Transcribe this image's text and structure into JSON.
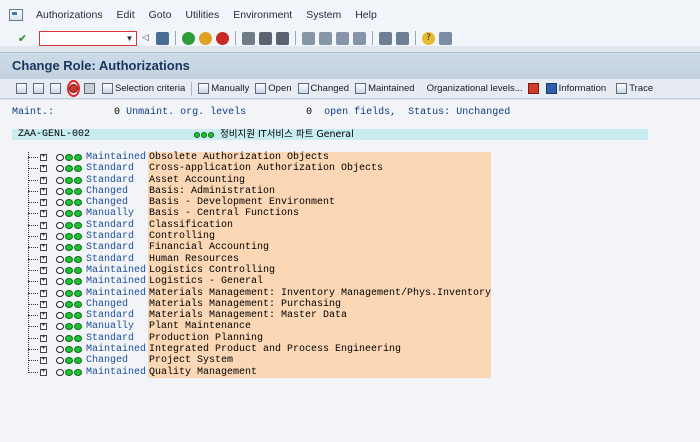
{
  "menu": {
    "items": [
      "Authorizations",
      "Edit",
      "Goto",
      "Utilities",
      "Environment",
      "System",
      "Help"
    ]
  },
  "command_field": {
    "value": "",
    "placeholder": ""
  },
  "title": "Change Role: Authorizations",
  "app_toolbar": {
    "selection_criteria": "Selection criteria",
    "manually": "Manually",
    "open": "Open",
    "changed": "Changed",
    "maintained": "Maintained",
    "org_levels": "Organizational levels...",
    "information": "Information",
    "trace": "Trace"
  },
  "status_line": {
    "maint_label": "Maint.:",
    "unmaint_count": "0",
    "unmaint_label": "Unmaint. org. levels",
    "open_count": "0",
    "open_label": "open fields,",
    "status_label": "Status:",
    "status_value": "Unchanged"
  },
  "role": {
    "id": "ZAA-GENL-002",
    "description": "정비지원 IT서비스 파트 General"
  },
  "tree": [
    {
      "status": "Maintained",
      "text": "Obsolete Authorization Objects"
    },
    {
      "status": "Standard",
      "text": "Cross-application Authorization Objects"
    },
    {
      "status": "Standard",
      "text": "Asset Accounting"
    },
    {
      "status": "Changed",
      "text": "Basis: Administration"
    },
    {
      "status": "Changed",
      "text": "Basis - Development Environment"
    },
    {
      "status": "Manually",
      "text": "Basis - Central Functions"
    },
    {
      "status": "Standard",
      "text": "Classification"
    },
    {
      "status": "Standard",
      "text": "Controlling"
    },
    {
      "status": "Standard",
      "text": "Financial Accounting"
    },
    {
      "status": "Standard",
      "text": "Human Resources"
    },
    {
      "status": "Maintained",
      "text": "Logistics Controlling"
    },
    {
      "status": "Maintained",
      "text": "Logistics - General"
    },
    {
      "status": "Maintained",
      "text": "Materials Management: Inventory Management/Phys.Inventory"
    },
    {
      "status": "Changed",
      "text": "Materials Management: Purchasing"
    },
    {
      "status": "Standard",
      "text": "Materials Management: Master Data"
    },
    {
      "status": "Manually",
      "text": "Plant Maintenance"
    },
    {
      "status": "Standard",
      "text": "Production Planning"
    },
    {
      "status": "Maintained",
      "text": "Integrated Product and Process Engineering"
    },
    {
      "status": "Changed",
      "text": "Project System"
    },
    {
      "status": "Maintained",
      "text": "Quality Management"
    }
  ],
  "colors": {
    "title": "#17365d",
    "tree_text_bg": "#fbd7b5",
    "role_bg": "#c9ecf0",
    "status_blue": "#1c4f9c",
    "light_green": "#1cc430"
  }
}
